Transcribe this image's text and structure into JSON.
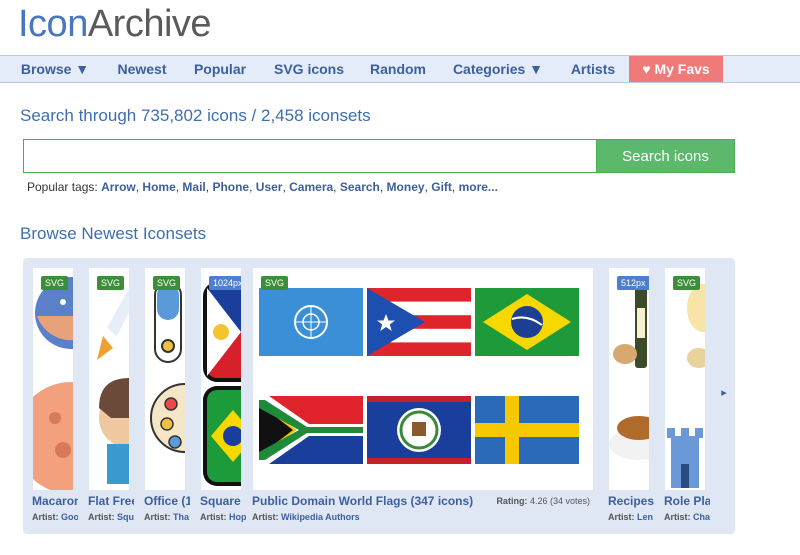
{
  "logo": {
    "part1": "Icon",
    "part2": "Archive"
  },
  "nav": {
    "items": [
      "Browse ▼",
      "Newest",
      "Popular",
      "SVG icons",
      "Random",
      "Categories ▼",
      "Artists"
    ],
    "favs": "♥ My Favs"
  },
  "search": {
    "heading": "Search through 735,802 icons / 2,458 iconsets",
    "placeholder": "",
    "button": "Search icons"
  },
  "tags": {
    "prefix": "Popular tags:",
    "items": [
      "Arrow",
      "Home",
      "Mail",
      "Phone",
      "User",
      "Camera",
      "Search",
      "Money",
      "Gift",
      "more..."
    ]
  },
  "browse": {
    "heading": "Browse Newest Iconsets",
    "artist_prefix": "Artist:",
    "rating_prefix": "Rating:",
    "cards": [
      {
        "badge": "SVG",
        "title": "Macaron",
        "artist": "Goodstuff"
      },
      {
        "badge": "SVG",
        "title": "Flat Free",
        "artist": "Squ"
      },
      {
        "badge": "SVG",
        "title": "Office (1",
        "artist": "Tha"
      },
      {
        "badge": "1024px",
        "title": "Square",
        "artist": "Hop"
      },
      {
        "badge": "SVG",
        "title": "Public Domain World Flags (347 icons)",
        "artist": "Wikipedia Authors",
        "rating": "4.26 (34 votes)"
      },
      {
        "badge": "512px",
        "title": "Recipes",
        "artist": "Len"
      },
      {
        "badge": "SVG",
        "title": "Role Pla",
        "artist": "Cha"
      }
    ],
    "next_arrow": "▸"
  },
  "colors": {
    "logo_blue": "#4a76c0",
    "nav_bg": "#e3ecf8",
    "link": "#3d5f9c",
    "favs_bg": "#f07a7a",
    "search_btn": "#5cb86b",
    "svg_badge": "#3b8f3b",
    "px_badge": "#4c7fd1"
  }
}
